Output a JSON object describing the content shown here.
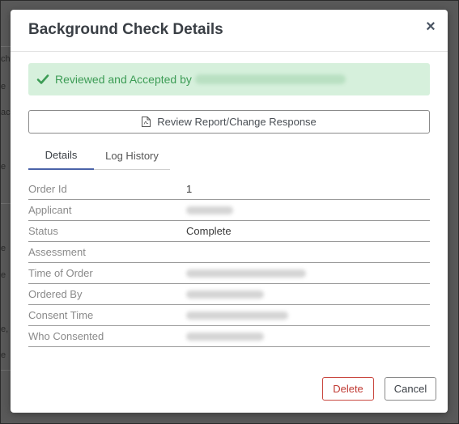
{
  "modal": {
    "title": "Background Check Details",
    "close_glyph": "×"
  },
  "alert": {
    "text": "Reviewed and Accepted by",
    "icon": "check-icon",
    "color": "#3c9c55"
  },
  "review_button": {
    "label": "Review Report/Change Response",
    "icon": "pdf-file-icon"
  },
  "tabs": [
    {
      "label": "Details",
      "active": true
    },
    {
      "label": "Log History",
      "active": false
    }
  ],
  "details": {
    "order_id": {
      "label": "Order Id",
      "value": "1"
    },
    "applicant": {
      "label": "Applicant"
    },
    "status": {
      "label": "Status",
      "value": "Complete"
    },
    "assessment": {
      "label": "Assessment",
      "value": ""
    },
    "time_of_order": {
      "label": "Time of Order"
    },
    "ordered_by": {
      "label": "Ordered By"
    },
    "consent_time": {
      "label": "Consent Time"
    },
    "who_consented": {
      "label": "Who Consented"
    }
  },
  "footer": {
    "delete_label": "Delete",
    "cancel_label": "Cancel"
  },
  "colors": {
    "delete": "#c03a33",
    "active_tab": "#4a63a8",
    "alert_bg": "#d6f0dc"
  }
}
